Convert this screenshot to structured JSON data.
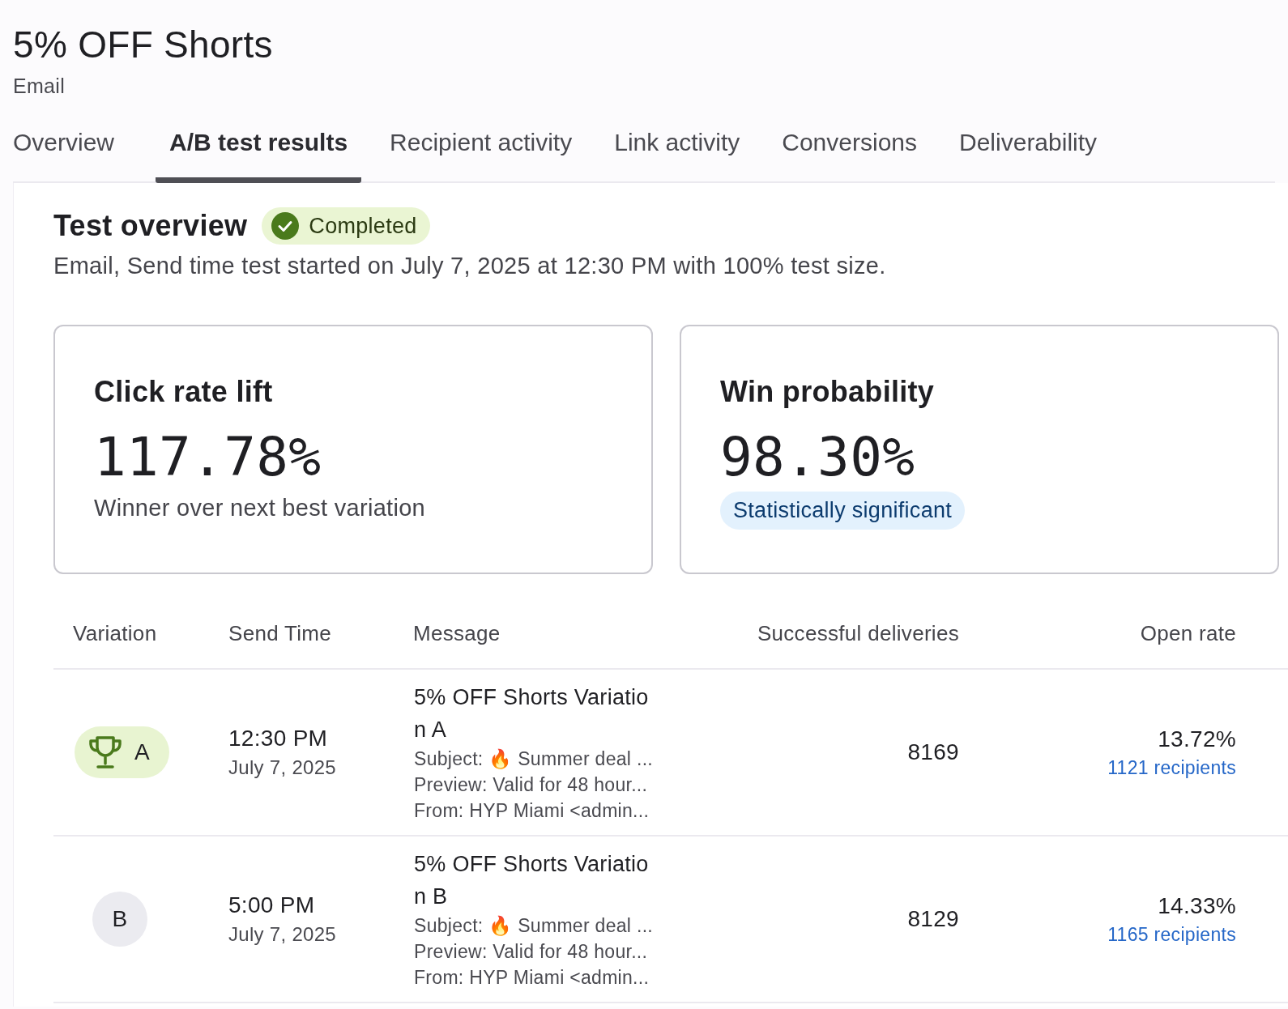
{
  "header": {
    "title": "5% OFF Shorts",
    "subtitle": "Email"
  },
  "tabs": [
    {
      "label": "Overview",
      "selected": false
    },
    {
      "label": "A/B test results",
      "selected": true
    },
    {
      "label": "Recipient activity",
      "selected": false
    },
    {
      "label": "Link activity",
      "selected": false
    },
    {
      "label": "Conversions",
      "selected": false
    },
    {
      "label": "Deliverability",
      "selected": false
    }
  ],
  "test_overview": {
    "heading": "Test overview",
    "status": "Completed",
    "description": "Email, Send time test started on July 7, 2025 at 12:30 PM with 100% test size."
  },
  "cards": [
    {
      "title": "Click rate lift",
      "value": "117.78%",
      "note": "Winner over next best variation",
      "kind": "text"
    },
    {
      "title": "Win probability",
      "value": "98.30%",
      "note": "Statistically significant",
      "kind": "pill"
    }
  ],
  "table": {
    "columns": [
      "Variation",
      "Send Time",
      "Message",
      "Successful deliveries",
      "Open rate"
    ],
    "rows": [
      {
        "variation": "A",
        "winner": true,
        "time": "12:30 PM",
        "date": "July 7, 2025",
        "message": "5% OFF Shorts Variation A",
        "subject": "Subject: 🔥 Summer deal ...",
        "preview": "Preview: Valid for 48 hour...",
        "from": "From: HYP Miami <admin...",
        "deliveries": "8169",
        "open_rate": "13.72%",
        "recipients": "1121 recipients"
      },
      {
        "variation": "B",
        "winner": false,
        "time": "5:00 PM",
        "date": "July 7, 2025",
        "message": "5% OFF Shorts Variation B",
        "subject": "Subject: 🔥 Summer deal ...",
        "preview": "Preview: Valid for 48 hour...",
        "from": "From: HYP Miami <admin...",
        "deliveries": "8129",
        "open_rate": "14.33%",
        "recipients": "1165 recipients"
      }
    ]
  }
}
